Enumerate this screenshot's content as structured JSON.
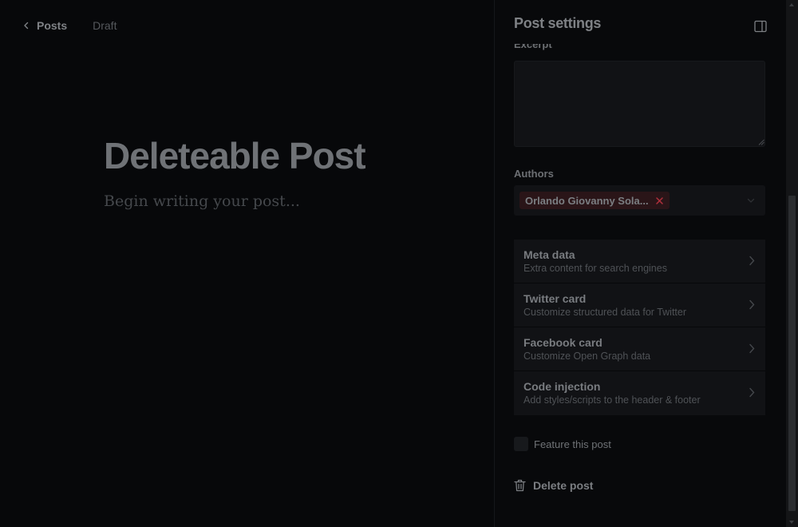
{
  "editor": {
    "back_label": "Posts",
    "status": "Draft",
    "title": "Deleteable Post",
    "body_placeholder": "Begin writing your post..."
  },
  "panel": {
    "title": "Post settings",
    "excerpt": {
      "label": "Excerpt",
      "value": ""
    },
    "authors": {
      "label": "Authors",
      "items": [
        {
          "name": "Orlando Giovanny Sola..."
        }
      ]
    },
    "menu": [
      {
        "title": "Meta data",
        "description": "Extra content for search engines"
      },
      {
        "title": "Twitter card",
        "description": "Customize structured data for Twitter"
      },
      {
        "title": "Facebook card",
        "description": "Customize Open Graph data"
      },
      {
        "title": "Code injection",
        "description": "Add styles/scripts to the header & footer"
      }
    ],
    "feature_label": "Feature this post",
    "feature_checked": false,
    "delete_label": "Delete post"
  },
  "icons": {
    "back": "chevron-left-icon",
    "panel_toggle": "sidebar-panel-icon",
    "remove_author": "close-icon",
    "authors_dropdown": "chevron-down-icon",
    "menu_arrow": "chevron-right-icon",
    "delete": "trash-icon"
  },
  "colors": {
    "background": "#07080a",
    "panel_field": "#111215",
    "author_chip": "#2a1518",
    "chip_remove": "#b0303c"
  }
}
